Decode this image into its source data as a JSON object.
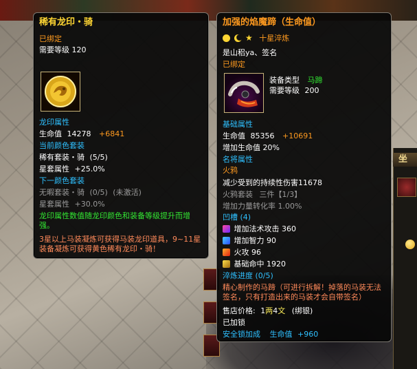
{
  "left": {
    "title": "稀有龙印・骑",
    "bound": "已绑定",
    "req_label": "需要等级",
    "req_value": "120",
    "seal_header": "龙印属性",
    "hp_label": "生命值",
    "hp_value": "14278",
    "hp_bonus": "+6841",
    "current_set_header": "当前颜色套装",
    "current_set_name": "稀有套装・骑",
    "current_set_count": "(5/5)",
    "current_set_attr_label": "星套属性",
    "current_set_attr_value": "+25.0%",
    "next_set_header": "下一颜色套装",
    "next_set_name": "无暇套装・骑",
    "next_set_count": "(0/5)",
    "next_set_state": "(未激活)",
    "next_set_attr_label": "星套属性",
    "next_set_attr_value": "+30.0%",
    "desc_green": "龙印属性数值随龙印颜色和装备等级提升而增强。",
    "desc_orange": "3星以上马装凝炼可获得马装龙印道具，9~11星装备凝炼可获得黄色稀有龙印・骑！"
  },
  "right": {
    "title": "加强的焰魔蹄（生命值）",
    "star_text": "十星淬炼",
    "signer": "是山稆ya、签名",
    "bound": "已绑定",
    "equip_type_label": "装备类型",
    "equip_type_value": "马蹄",
    "req_label": "需要等级",
    "req_value": "200",
    "base_header": "基础属性",
    "hp_label": "生命值",
    "hp_value": "85356",
    "hp_bonus": "+10691",
    "hp_pct": "增加生命值 20%",
    "general_header": "名将属性",
    "general_name": "火鸦",
    "general_effect": "减少受到的持续性伤害11678",
    "set_name": "火鸦套装",
    "set_piece": "三件【1/3】",
    "set_effect": "增加力量转化率 1.00%",
    "slots_header": "凹槽 (4)",
    "gem1": "增加法术攻击 360",
    "gem2": "增加智力 90",
    "gem3": "火攻 96",
    "gem4": "基础命中 1920",
    "refine": "淬炼进度 (0/5)",
    "desc": "精心制作的马蹄（可进行拆解！掉落的马装无法签名，只有打造出来的马装才会自带签名）",
    "price_label": "售店价格:",
    "price_gold": "1",
    "price_gold_unit": "两",
    "price_silver": "4",
    "price_silver_unit": "文",
    "price_note": "(绑银)",
    "locked": "已加锁",
    "lock_bonus_label": "安全锁加成",
    "lock_bonus_attr": "生命值",
    "lock_bonus_value": "+960"
  },
  "background": {
    "side_tab": "坐"
  },
  "colors": {
    "title_gold": "#ffd633",
    "label_orange": "#ff9a1f",
    "header_cyan": "#2fc0ff",
    "positive_green": "#33e633",
    "inactive_gray": "#9a9a9a",
    "desc_orange": "#ff8a5a"
  },
  "icons": {
    "left_item": "golden-dragon-seal-icon",
    "right_item": "flame-demon-hoof-icon",
    "gem_icons": [
      "magic-gem-icon",
      "intellect-gem-icon",
      "fire-gem-icon",
      "hit-gem-icon"
    ]
  }
}
